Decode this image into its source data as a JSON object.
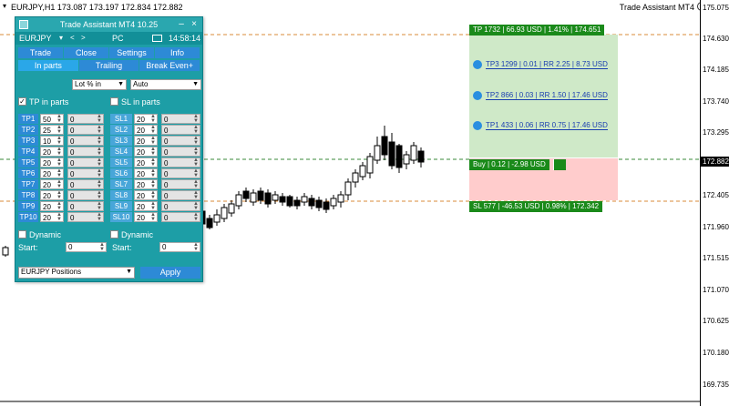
{
  "chart_header": {
    "symbol_line": "EURJPY,H1  173.087 173.197 172.834 172.882",
    "expert_name": "Trade Assistant MT4",
    "smile": "☺"
  },
  "price_axis": {
    "labels": [
      "175.075",
      "174.630",
      "174.185",
      "173.740",
      "173.295",
      "172.405",
      "171.960",
      "171.515",
      "171.070",
      "170.625",
      "170.180",
      "169.735"
    ],
    "current": "172.882"
  },
  "zones": {
    "tp_box": "TP 1732 | 66.93 USD | 1.41% | 174.651",
    "sl_box": "SL 577 | -46.53 USD | 0.98% | 172.342",
    "buy_box": "Buy | 0.12 | -2.98 USD",
    "tp_levels": [
      "TP3 1299 | 0.01 | RR 2.25 | 8.73 USD",
      "TP2 866 | 0.03 | RR 1.50 | 17.46 USD",
      "TP1 433 | 0.06 | RR 0.75 | 17.46 USD"
    ]
  },
  "panel": {
    "title": "Trade Assistant MT4 10.25",
    "minimize": "–",
    "close": "×",
    "symbol": "EURJPY",
    "arrow_left": "<",
    "arrow_right": ">",
    "account": "PC",
    "time": "14:58:14",
    "main_tabs": [
      "Trade",
      "Close",
      "Settings",
      "Info"
    ],
    "sub_tabs": [
      "In parts",
      "Trailing",
      "Break Even+"
    ],
    "lot_mode": "Lot % in",
    "auto_mode": "Auto",
    "tp_in_parts": "TP in parts",
    "sl_in_parts": "SL in parts",
    "tp_rows": [
      {
        "label": "TP1",
        "pct": "50",
        "val": "0"
      },
      {
        "label": "TP2",
        "pct": "25",
        "val": "0"
      },
      {
        "label": "TP3",
        "pct": "10",
        "val": "0"
      },
      {
        "label": "TP4",
        "pct": "20",
        "val": "0"
      },
      {
        "label": "TP5",
        "pct": "20",
        "val": "0"
      },
      {
        "label": "TP6",
        "pct": "20",
        "val": "0"
      },
      {
        "label": "TP7",
        "pct": "20",
        "val": "0"
      },
      {
        "label": "TP8",
        "pct": "20",
        "val": "0"
      },
      {
        "label": "TP9",
        "pct": "20",
        "val": "0"
      },
      {
        "label": "TP10",
        "pct": "20",
        "val": "0"
      }
    ],
    "sl_rows": [
      {
        "label": "SL1",
        "pct": "20",
        "val": "0"
      },
      {
        "label": "SL2",
        "pct": "20",
        "val": "0"
      },
      {
        "label": "SL3",
        "pct": "20",
        "val": "0"
      },
      {
        "label": "SL4",
        "pct": "20",
        "val": "0"
      },
      {
        "label": "SL5",
        "pct": "20",
        "val": "0"
      },
      {
        "label": "SL6",
        "pct": "20",
        "val": "0"
      },
      {
        "label": "SL7",
        "pct": "20",
        "val": "0"
      },
      {
        "label": "SL8",
        "pct": "20",
        "val": "0"
      },
      {
        "label": "SL9",
        "pct": "20",
        "val": "0"
      },
      {
        "label": "SL10",
        "pct": "20",
        "val": "0"
      }
    ],
    "dynamic_label": "Dynamic",
    "start_label": "Start:",
    "start_tp": "0",
    "start_sl": "0",
    "positions": "EURJPY Positions",
    "apply": "Apply"
  }
}
